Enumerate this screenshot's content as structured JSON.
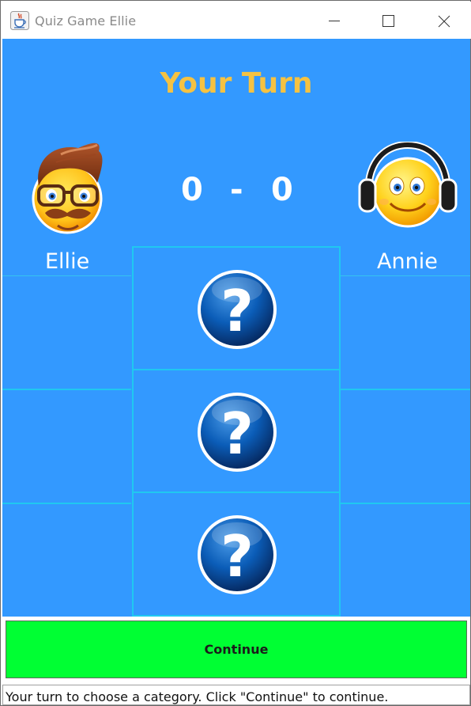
{
  "window": {
    "title": "Quiz Game Ellie",
    "app_icon": "java-cup-icon",
    "controls": [
      "minimize-icon",
      "maximize-icon",
      "close-icon"
    ]
  },
  "header": {
    "turn_label": "Your Turn"
  },
  "score": {
    "left": "0",
    "separator": "-",
    "right": "0"
  },
  "players": {
    "left": {
      "name": "Ellie",
      "avatar": "hipster-emoji-avatar"
    },
    "right": {
      "name": "Annie",
      "avatar": "headphones-emoji-avatar"
    }
  },
  "categories": [
    {
      "icon": "question-mark-icon"
    },
    {
      "icon": "question-mark-icon"
    },
    {
      "icon": "question-mark-icon"
    }
  ],
  "continue_label": "Continue",
  "status_text": "Your turn to choose a category. Click \"Continue\" to continue.",
  "colors": {
    "background": "#3399ff",
    "title": "#f5c242",
    "grid_lines": "#20c8f0",
    "continue_button": "#00ff33"
  }
}
